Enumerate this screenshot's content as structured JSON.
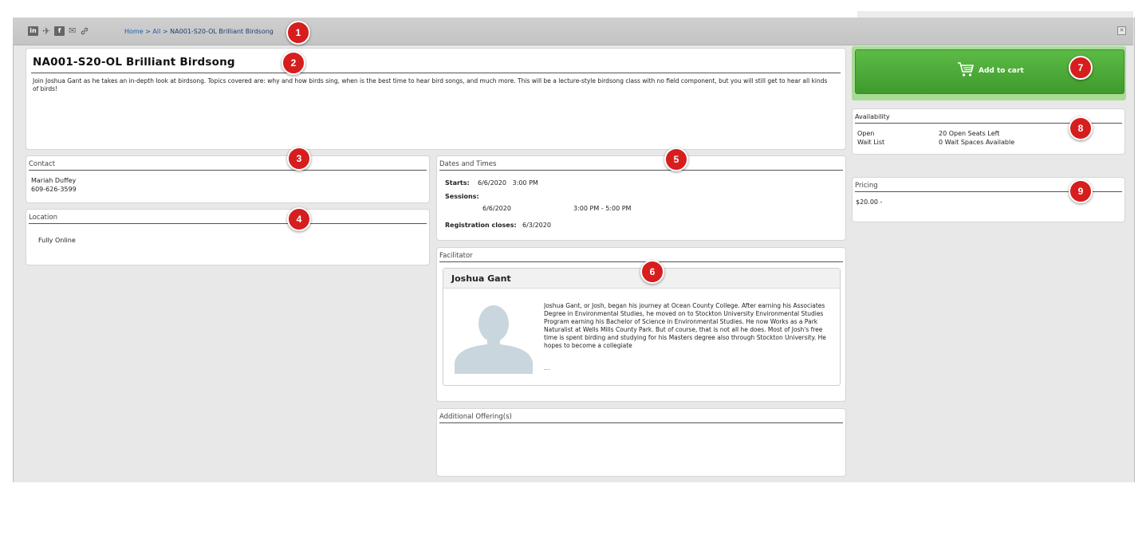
{
  "toolbar": {
    "social": [
      "in",
      "✈",
      "f",
      "✉",
      "🔗"
    ],
    "breadcrumb": {
      "home": "Home",
      "sep1": ">",
      "all": "All",
      "sep2": ">",
      "current": "NA001-S20-OL  Brilliant Birdsong"
    },
    "close": "✕"
  },
  "course": {
    "title": "NA001-S20-OL  Brilliant Birdsong",
    "description": "Join Joshua Gant as he takes an in-depth look at birdsong. Topics covered are: why and how birds sing, when is the best time to hear bird songs, and much more. This will be a lecture-style birdsong class with no field component, but you will still get to hear all kinds of birds!"
  },
  "contact": {
    "heading": "Contact",
    "name": "Mariah Duffey",
    "phone": "609-626-3599"
  },
  "location": {
    "heading": "Location",
    "value": "Fully Online"
  },
  "dates": {
    "heading": "Dates and Times",
    "starts_label": "Starts:",
    "starts_value": "6/6/2020   3:00 PM",
    "sessions_label": "Sessions:",
    "session_date": "6/6/2020",
    "session_time": "3:00 PM - 5:00 PM",
    "reg_label": "Registration closes:",
    "reg_value": "6/3/2020"
  },
  "facilitator": {
    "heading": "Facilitator",
    "name": "Joshua  Gant",
    "bio": "Joshua Gant, or Josh, began his journey at Ocean County College. After earning his Associates Degree in Environmental Studies, he moved on to Stockton University Environmental Studies Program earning his Bachelor of Science in Environmental Studies. He now Works as a Park Naturalist at Wells Mills County Park. But of course, that is not all he does. Most of Josh's free time is spent birding and studying for his Masters degree also through Stockton University. He hopes to become a collegiate",
    "more": "..."
  },
  "additional": {
    "heading": "Additional Offering(s)"
  },
  "cart": {
    "label": "Add to cart",
    "icon": "cart-icon"
  },
  "availability": {
    "heading": "Availability",
    "open_label": "Open",
    "open_value": "20 Open Seats Left",
    "wait_label": "Wait List",
    "wait_value": "0 Wait Spaces Available"
  },
  "pricing": {
    "heading": "Pricing",
    "value": "$20.00 -"
  },
  "badges": [
    "1",
    "2",
    "3",
    "4",
    "5",
    "6",
    "7",
    "8",
    "9"
  ],
  "colors": {
    "badge": "#d61e1e",
    "cart_green": "#4caf3a",
    "cart_outer": "#a8dc95",
    "link": "#2060b0"
  }
}
